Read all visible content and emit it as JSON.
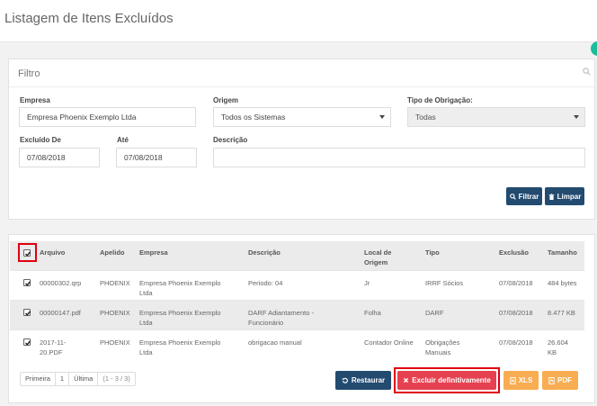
{
  "page": {
    "title": "Listagem de Itens Excluídos"
  },
  "filter": {
    "title": "Filtro",
    "empresa": {
      "label": "Empresa",
      "value": "Empresa Phoenix Exemplo Ltda"
    },
    "origem": {
      "label": "Origem",
      "value": "Todos os Sistemas"
    },
    "tipo": {
      "label": "Tipo de Obrigação:",
      "value": "Todas"
    },
    "excluido_de": {
      "label": "Excluído De",
      "value": "07/08/2018"
    },
    "ate": {
      "label": "Até",
      "value": "07/08/2018"
    },
    "descricao": {
      "label": "Descrição",
      "value": ""
    },
    "filtrar_label": "Filtrar",
    "limpar_label": "Limpar"
  },
  "table": {
    "headers": {
      "arquivo": "Arquivo",
      "apelido": "Apelido",
      "empresa": "Empresa",
      "descricao": "Descrição",
      "local_l1": "Local de",
      "local_l2": "Origem",
      "tipo": "Tipo",
      "exclusao": "Exclusão",
      "tamanho": "Tamanho"
    },
    "rows": [
      {
        "arquivo": [
          "00000302.qrp"
        ],
        "apelido": "PHOENIX",
        "empresa": [
          "Empresa Phoenix Exemplo",
          "Ltda"
        ],
        "descricao": [
          "Periodo: 04"
        ],
        "local": "Jr",
        "tipo": [
          "IRRF Sócios"
        ],
        "exclusao": "07/08/2018",
        "tamanho": [
          "484 bytes"
        ],
        "checked": true
      },
      {
        "arquivo": [
          "00000147.pdf"
        ],
        "apelido": "PHOENIX",
        "empresa": [
          "Empresa Phoenix Exemplo",
          "Ltda"
        ],
        "descricao": [
          "DARF Adiantamento -",
          "Funcionário"
        ],
        "local": "Folha",
        "tipo": [
          "DARF"
        ],
        "exclusao": "07/08/2018",
        "tamanho": [
          "8.477 KB"
        ],
        "checked": true
      },
      {
        "arquivo": [
          "2017-11-",
          "20.PDF"
        ],
        "apelido": "PHOENIX",
        "empresa": [
          "Empresa Phoenix Exemplo",
          "Ltda"
        ],
        "descricao": [
          "obrigacao manual"
        ],
        "local": "Contador Online",
        "tipo": [
          "Obrigações",
          "Manuais"
        ],
        "exclusao": "07/08/2018",
        "tamanho": [
          "26.604",
          "KB"
        ],
        "checked": true
      }
    ]
  },
  "pager": {
    "first": "Primeira",
    "page": "1",
    "last": "Última",
    "range": "(1 - 3 / 3)"
  },
  "actions": {
    "restaurar": "Restaurar",
    "excluir": "Excluir definitivamente",
    "xls": "XLS",
    "pdf": "PDF"
  },
  "colors": {
    "primary": "#234b70",
    "danger": "#e64150",
    "warning": "#f8ad52",
    "highlight": "#e00010"
  }
}
